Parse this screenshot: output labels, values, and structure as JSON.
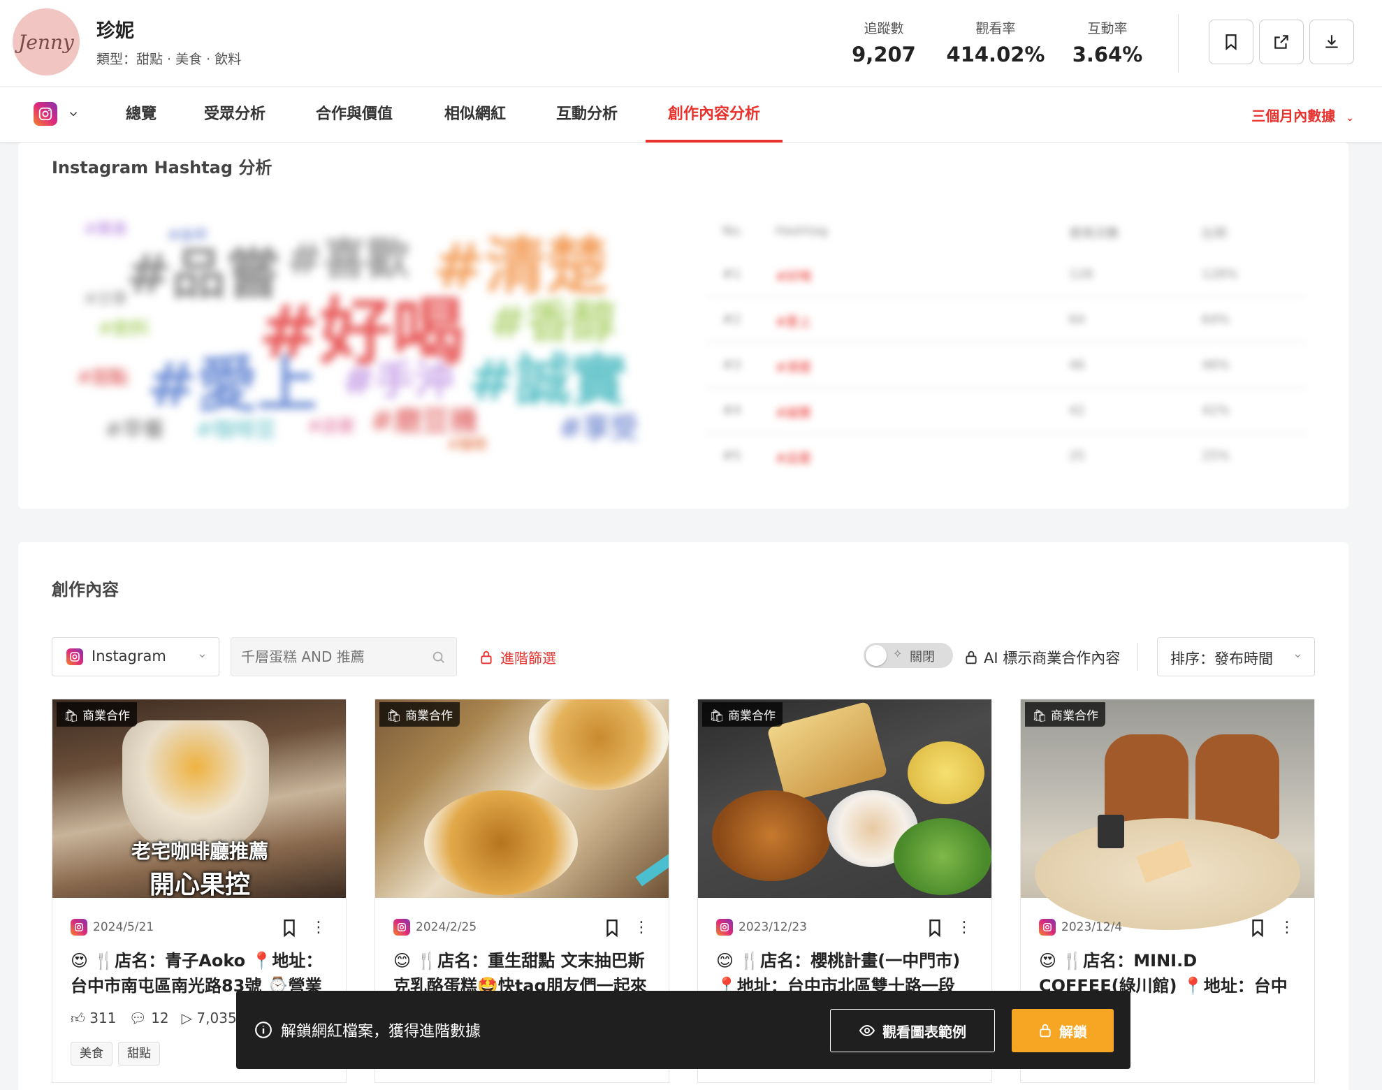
{
  "profile": {
    "avatar_text": "Jenny",
    "name": "珍妮",
    "type_line": "類型：甜點 · 美食 · 飲料",
    "stats": [
      {
        "label": "追蹤數",
        "value": "9,207"
      },
      {
        "label": "觀看率",
        "value": "414.02%"
      },
      {
        "label": "互動率",
        "value": "3.64%"
      }
    ]
  },
  "header_buttons": [
    "bookmark-icon",
    "external-link-icon",
    "download-icon"
  ],
  "tabs": [
    {
      "label": "總覽"
    },
    {
      "label": "受眾分析"
    },
    {
      "label": "合作與價值"
    },
    {
      "label": "相似網紅"
    },
    {
      "label": "互動分析"
    },
    {
      "label": "創作內容分析",
      "active": true
    }
  ],
  "date_range": "三個月內數據",
  "accent_color": "#e8322d",
  "unlock_color": "#f6a623",
  "hashtag_section": {
    "title": "Instagram Hashtag 分析",
    "cloud_words": [
      "#品嘗",
      "#喜歡",
      "#清楚",
      "#好喝",
      "#香醇",
      "#愛上",
      "#手沖",
      "#誠實",
      "#磨豆機",
      "#享受",
      "#咖啡豆",
      "#早餐",
      "#甜點",
      "#店家",
      "#飲料",
      "#美食",
      "#台中",
      "#分享",
      "#咖啡"
    ],
    "table_headers": [
      "No.",
      "Hashtag",
      "使用次數",
      "比例"
    ],
    "table_rows": [
      {
        "no": "#1",
        "tag": "#好喝",
        "count": "128",
        "pct": "128%"
      },
      {
        "no": "#2",
        "tag": "#愛上",
        "count": "64",
        "pct": "64%"
      },
      {
        "no": "#3",
        "tag": "#清楚",
        "count": "46",
        "pct": "46%"
      },
      {
        "no": "#4",
        "tag": "#誠實",
        "count": "42",
        "pct": "42%"
      },
      {
        "no": "#5",
        "tag": "#品嘗",
        "count": "25",
        "pct": "25%"
      }
    ]
  },
  "content_section": {
    "title": "創作內容",
    "platform_select": "Instagram",
    "search_placeholder": "千層蛋糕 AND 推薦",
    "advanced_filter": "進階篩選",
    "toggle_label": "關閉",
    "ai_label": "AI 標示商業合作內容",
    "sort_label": "排序：發布時間"
  },
  "posts": [
    {
      "badge": "商業合作",
      "date": "2024/5/21",
      "text": "😍 🍴店名：青子Aoko 📍地址：台中市南屯區南光路83號 ⌚營業時間",
      "overlay_line1": "老宅咖啡廳推薦",
      "overlay_line2": "開心果控",
      "likes": "311",
      "comments": "12",
      "views": "7,035",
      "tags": [
        "美食",
        "甜點"
      ]
    },
    {
      "badge": "商業合作",
      "date": "2024/2/25",
      "text": "😊 🍴店名：重生甜點 文末抽巴斯克乳酪蛋糕🤩快tag朋友們一起來"
    },
    {
      "badge": "商業合作",
      "date": "2023/12/23",
      "text": "😊 🍴店名：櫻桃計畫(一中門市) 📍地址：台中市北區雙十路一段"
    },
    {
      "badge": "商業合作",
      "date": "2023/12/4",
      "text": "😍 🍴店名：MINI.D COFFEE(綠川館) 📍地址：台中市中區"
    }
  ],
  "banner": {
    "text": "解鎖網紅檔案，獲得進階數據",
    "view_example": "觀看圖表範例",
    "unlock": "解鎖"
  }
}
